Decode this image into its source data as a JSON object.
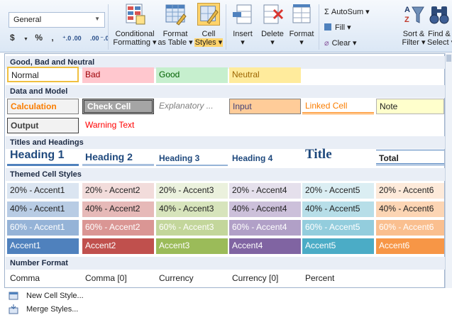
{
  "ribbon": {
    "number_format": "General",
    "currency": "$",
    "percent": "%",
    "comma": ",",
    "inc_decimal": "⁺.0 .00",
    "dec_decimal": ".00 ⁻.0",
    "conditional": [
      "Conditional",
      "Formatting ▾"
    ],
    "format_table": [
      "Format",
      "as Table ▾"
    ],
    "cell_styles": [
      "Cell",
      "Styles ▾"
    ],
    "insert": [
      "Insert",
      "▾"
    ],
    "delete": [
      "Delete",
      "▾"
    ],
    "format": [
      "Format",
      "▾"
    ],
    "autosum": "Σ  AutoSum ▾",
    "fill": "Fill ▾",
    "clear": "Clear ▾",
    "sort": [
      "Sort &",
      "Filter ▾"
    ],
    "find": [
      "Find &",
      "Select ▾"
    ]
  },
  "sections": {
    "good_bad": "Good, Bad and Neutral",
    "data_model": "Data and Model",
    "titles": "Titles and Headings",
    "themed": "Themed Cell Styles",
    "number": "Number Format"
  },
  "good_bad": [
    "Normal",
    "Bad",
    "Good",
    "Neutral"
  ],
  "data_model_1": [
    "Calculation",
    "Check Cell",
    "Explanatory ...",
    "Input",
    "Linked Cell",
    "Note"
  ],
  "data_model_2": [
    "Output",
    "Warning Text"
  ],
  "titles": [
    "Heading 1",
    "Heading 2",
    "Heading 3",
    "Heading 4",
    "Title",
    "Total"
  ],
  "themed_20": [
    "20% - Accent1",
    "20% - Accent2",
    "20% - Accent3",
    "20% - Accent4",
    "20% - Accent5",
    "20% - Accent6"
  ],
  "themed_40": [
    "40% - Accent1",
    "40% - Accent2",
    "40% - Accent3",
    "40% - Accent4",
    "40% - Accent5",
    "40% - Accent6"
  ],
  "themed_60": [
    "60% - Accent1",
    "60% - Accent2",
    "60% - Accent3",
    "60% - Accent4",
    "60% - Accent5",
    "60% - Accent6"
  ],
  "themed_100": [
    "Accent1",
    "Accent2",
    "Accent3",
    "Accent4",
    "Accent5",
    "Accent6"
  ],
  "number_format": [
    "Comma",
    "Comma [0]",
    "Currency",
    "Currency [0]",
    "Percent"
  ],
  "menu": {
    "new_style": "New Cell Style...",
    "merge_styles": "Merge Styles..."
  },
  "colors": {
    "accent1": "#4f81bd",
    "accent2": "#c0504d",
    "accent3": "#9bbb59",
    "accent4": "#8064a2",
    "accent5": "#4bacc6",
    "accent6": "#f79646"
  }
}
